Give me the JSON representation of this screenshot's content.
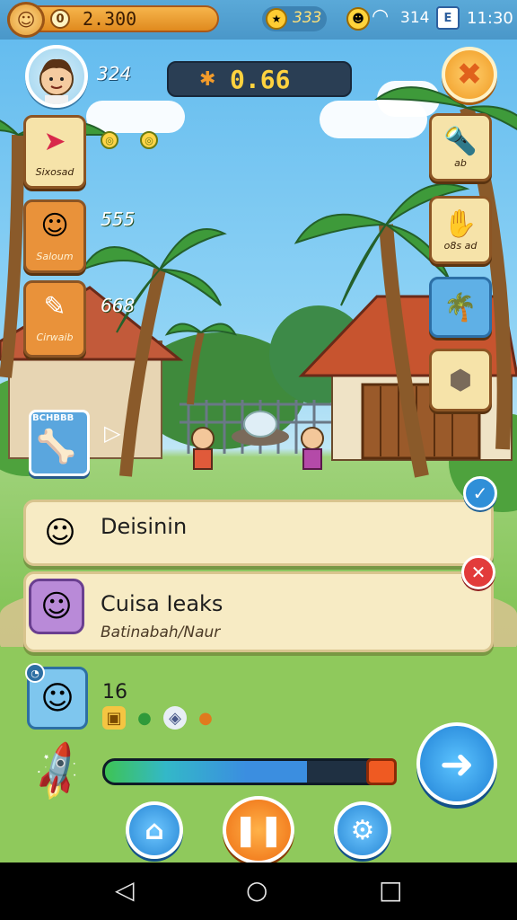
{
  "status_bar": {
    "coins": "2.300",
    "coin_symbol": "0",
    "gems": "333",
    "signal": "314",
    "time": "11:30",
    "calendar_glyph": "E"
  },
  "player": {
    "level": "324"
  },
  "timer": {
    "value": "0.66"
  },
  "left_items": [
    {
      "label": "Sixosad",
      "count": ""
    },
    {
      "label": "Saloum",
      "count": "555"
    },
    {
      "label": "Cirwaib",
      "count": "668"
    }
  ],
  "quest": {
    "label": "BCHBBB"
  },
  "right_items": [
    {
      "label": "ab"
    },
    {
      "label": "o8s ad"
    }
  ],
  "notifications": [
    {
      "title": "Deisinin"
    },
    {
      "title": "Cuisa Ieaks",
      "subtitle": "Batinabah/Naur"
    }
  ],
  "team": {
    "value": "16"
  },
  "progress": {
    "fraction": 0.7
  },
  "colors": {
    "accent": "#2786d4",
    "pause": "#ee6d12",
    "close": "#e23b3b"
  },
  "icons": {
    "home": "⌂",
    "pause": "❚❚",
    "settings": "⚙",
    "next": "➜"
  }
}
